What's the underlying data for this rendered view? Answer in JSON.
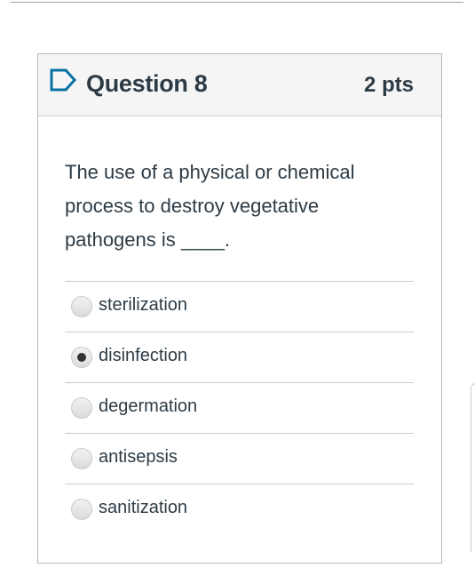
{
  "question": {
    "title": "Question 8",
    "points": "2 pts",
    "text": "The use of a physical or chemical process to destroy vegetative pathogens is ____.",
    "flag_icon": "flag-outline-icon"
  },
  "answers": [
    {
      "label": "sterilization",
      "selected": false
    },
    {
      "label": "disinfection",
      "selected": true
    },
    {
      "label": "degermation",
      "selected": false
    },
    {
      "label": "antisepsis",
      "selected": false
    },
    {
      "label": "sanitization",
      "selected": false
    }
  ],
  "colors": {
    "text": "#2d3b45",
    "header_bg": "#f5f5f5",
    "border": "#c7cdd1",
    "flag": "#0770a3"
  }
}
